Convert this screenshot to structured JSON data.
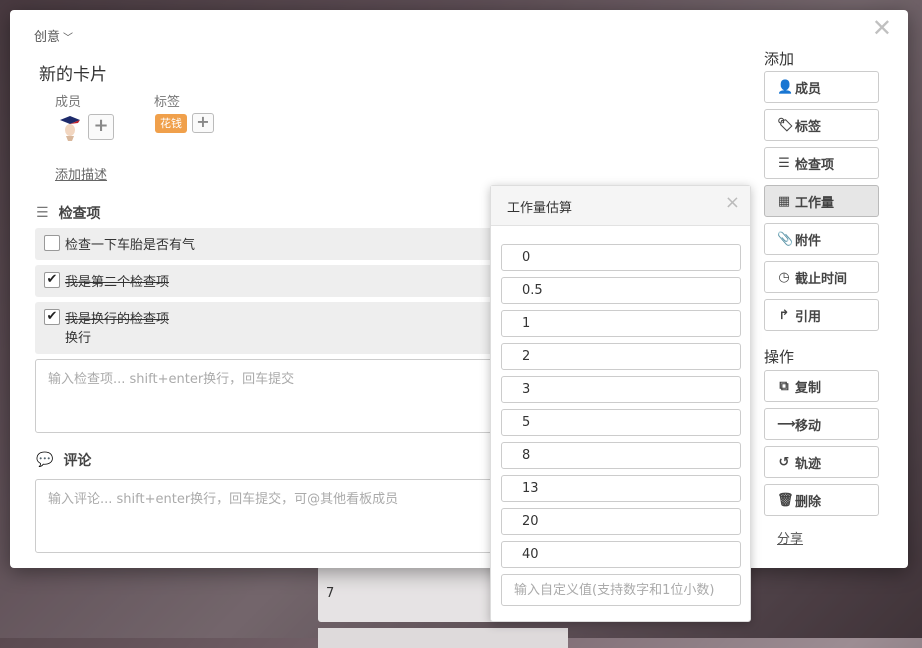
{
  "breadcrumb": "创意",
  "card_title": "新的卡片",
  "members_label": "成员",
  "tags_label": "标签",
  "tag_chip": "花钱",
  "add_description": "添加描述",
  "checklist": {
    "title": "检查项",
    "items": [
      {
        "text": "检查一下车胎是否有气",
        "done": false
      },
      {
        "text": "我是第二个检查项",
        "done": true
      },
      {
        "text": "我是换行的检查项",
        "line2": "换行",
        "done": true
      }
    ],
    "input_placeholder": "输入检查项... shift+enter换行，回车提交"
  },
  "comments": {
    "title": "评论",
    "input_placeholder": "输入评论... shift+enter换行，回车提交，可@其他看板成员"
  },
  "sidebar": {
    "add_heading": "添加",
    "add_buttons": [
      "成员",
      "标签",
      "检查项",
      "工作量",
      "附件",
      "截止时间",
      "引用"
    ],
    "ops_heading": "操作",
    "ops_buttons": [
      "复制",
      "移动",
      "轨迹",
      "删除"
    ],
    "share": "分享"
  },
  "workload_popup": {
    "title": "工作量估算",
    "options": [
      "0",
      "0.5",
      "1",
      "2",
      "3",
      "5",
      "8",
      "13",
      "20",
      "40"
    ],
    "custom_placeholder": "输入自定义值(支持数字和1位小数)"
  },
  "background_card_text": "7"
}
